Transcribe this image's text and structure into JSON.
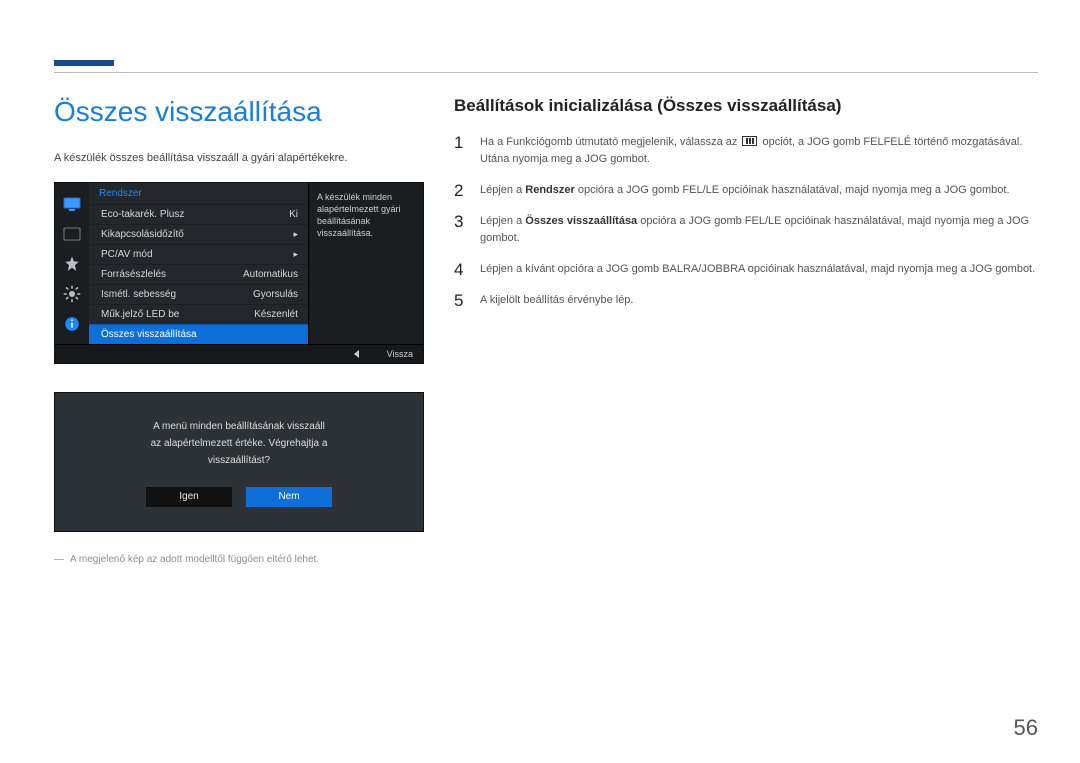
{
  "header": {
    "title": "Összes visszaállítása",
    "intro": "A készülék összes beállítása visszaáll a gyári alapértékekre."
  },
  "panel": {
    "menu_title": "Rendszer",
    "items": [
      {
        "label": "Eco-takarék. Plusz",
        "value": "Ki",
        "arrow": false
      },
      {
        "label": "Kikapcsolásidőzítő",
        "value": "",
        "arrow": true
      },
      {
        "label": "PC/AV mód",
        "value": "",
        "arrow": true
      },
      {
        "label": "Forrásészlelés",
        "value": "Automatikus",
        "arrow": false
      },
      {
        "label": "Ismétl. sebesség",
        "value": "Gyorsulás",
        "arrow": false
      },
      {
        "label": "Műk.jelző LED be",
        "value": "Készenlét",
        "arrow": false
      },
      {
        "label": "Összes visszaállítása",
        "value": "",
        "arrow": false,
        "selected": true
      }
    ],
    "desc": "A készülék minden alapértelmezett gyári beállításának visszaállítása.",
    "footer_back": "Vissza"
  },
  "dialog": {
    "line1": "A menü minden beállításának visszaáll",
    "line2": "az alapértelmezett értéke. Végrehajtja a",
    "line3": "visszaállítást?",
    "yes": "Igen",
    "no": "Nem"
  },
  "footnote": "A megjelenő kép az adott modelltől függően eltérő lehet.",
  "right": {
    "subtitle": "Beállítások inicializálása (Összes visszaállítása)",
    "steps": {
      "s1a": "Ha a Funkciógomb útmutató megjelenik, válassza az ",
      "s1b": " opciót, a JOG gomb FELFELÉ történő mozgatásával. Utána nyomja meg a JOG gombot.",
      "s2a": "Lépjen a ",
      "s2b": "Rendszer",
      "s2c": " opcióra a JOG gomb FEL/LE opcióinak használatával, majd nyomja meg a JOG gombot.",
      "s3a": "Lépjen a ",
      "s3b": "Összes visszaállítása",
      "s3c": " opcióra a JOG gomb FEL/LE opcióinak használatával, majd nyomja meg a JOG gombot.",
      "s4": "Lépjen a kívánt opcióra a JOG gomb BALRA/JOBBRA opcióinak használatával, majd nyomja meg a JOG gombot.",
      "s5": "A kijelölt beállítás érvénybe lép."
    }
  },
  "page_number": "56"
}
